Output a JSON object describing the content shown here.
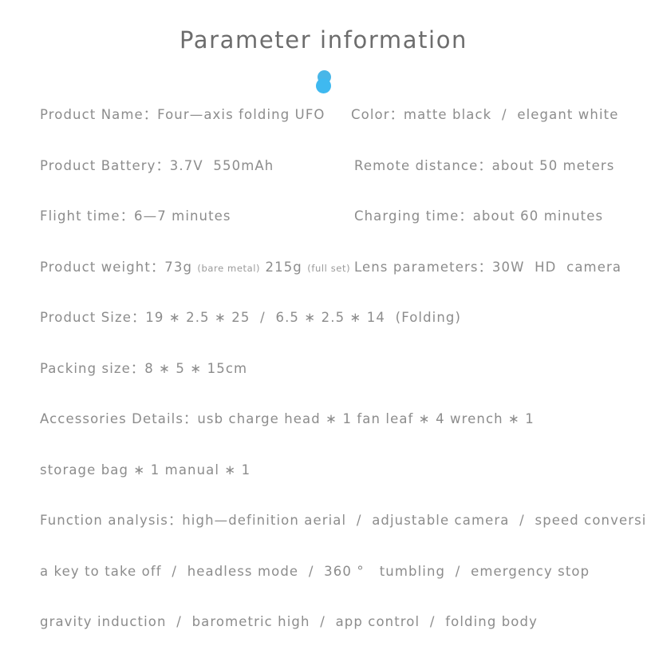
{
  "page": {
    "background_color": "#ffffff",
    "text_color": "#8c8c8c",
    "title_color": "#6d6d6d",
    "accent_color": "#3fb9f0"
  },
  "header": {
    "title": "Parameter information",
    "decoration": {
      "icon_top": "circle-dot-icon",
      "icon_bottom": "circle-dot-icon",
      "color": "#3fb9f0"
    }
  },
  "specs": {
    "rows": [
      {
        "left": {
          "label": "Product Name",
          "separator": "：",
          "value": "Four—axis folding UFO"
        },
        "right": {
          "label": "Color",
          "separator": "：",
          "value": "matte black  /  elegant white"
        }
      },
      {
        "left": {
          "label": "Product Battery",
          "separator": "：",
          "value": "3.7V  550mAh"
        },
        "right": {
          "label": "Remote distance",
          "separator": "：",
          "value": "about 50 meters"
        }
      },
      {
        "left": {
          "label": "Flight time",
          "separator": "：",
          "value": "6—7 minutes"
        },
        "right": {
          "label": "Charging time",
          "separator": "：",
          "value": "about 60 minutes"
        }
      },
      {
        "left": {
          "label": "Product weight",
          "separator": "：",
          "value": "73g",
          "note_1": "(bare metal)",
          "value_2": "215g",
          "note_2": "(full set)"
        },
        "right": {
          "label": "Lens parameters",
          "separator": "：",
          "value": "30W  HD  camera"
        }
      },
      {
        "left": {
          "label": "Product Size",
          "separator": "：",
          "value": "19 ∗ 2.5 ∗ 25  /  6.5 ∗ 2.5 ∗ 14  (Folding)"
        },
        "right": null
      },
      {
        "left": {
          "label": "Packing size",
          "separator": "：",
          "value": "8 ∗ 5 ∗ 15cm"
        },
        "right": null
      },
      {
        "left": {
          "label": "Accessories Details",
          "separator": "：",
          "value": "usb charge head ∗ 1 fan leaf ∗ 4 wrench ∗ 1"
        },
        "right": null
      },
      {
        "left": {
          "label": "",
          "separator": "",
          "value": "storage bag ∗ 1 manual ∗ 1"
        },
        "right": null
      },
      {
        "left": {
          "label": "Function analysis",
          "separator": "：",
          "value": "high—definition aerial  /  adjustable camera  /  speed conversion"
        },
        "right": null
      },
      {
        "left": {
          "label": "",
          "separator": "",
          "value": "a key to take off  /  headless mode  /  360 °   tumbling  /  emergency stop"
        },
        "right": null
      },
      {
        "left": {
          "label": "",
          "separator": "",
          "value": "gravity induction  /  barometric high  /  app control  /  folding body"
        },
        "right": null
      }
    ]
  }
}
